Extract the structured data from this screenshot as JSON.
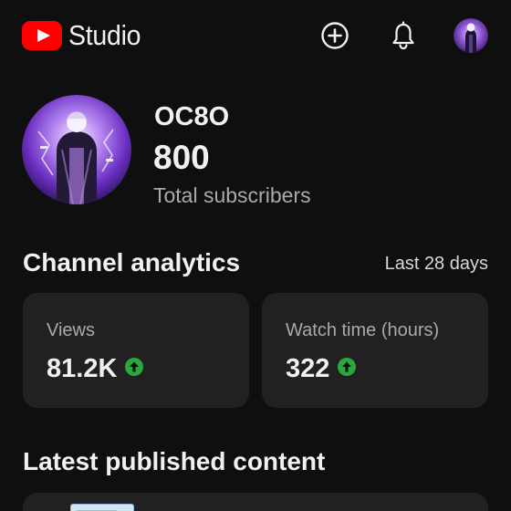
{
  "app": {
    "logo_text": "Studio",
    "brand_color": "#ff0000"
  },
  "header": {
    "icons": [
      "youtube-logo-icon",
      "create-icon",
      "notifications-bell-icon",
      "account-avatar"
    ]
  },
  "channel": {
    "name": "OC8O",
    "subscriber_count": "800",
    "subscriber_label": "Total subscribers"
  },
  "analytics": {
    "title": "Channel analytics",
    "range_label": "Last 28 days",
    "cards": [
      {
        "label": "Views",
        "value": "81.2K",
        "trend": "up",
        "trend_color": "#2ba640"
      },
      {
        "label": "Watch time (hours)",
        "value": "322",
        "trend": "up",
        "trend_color": "#2ba640"
      }
    ]
  },
  "latest": {
    "title": "Latest published content"
  },
  "colors": {
    "background": "#0f0f0f",
    "card": "#212121",
    "secondary_text": "#aaaaaa"
  }
}
